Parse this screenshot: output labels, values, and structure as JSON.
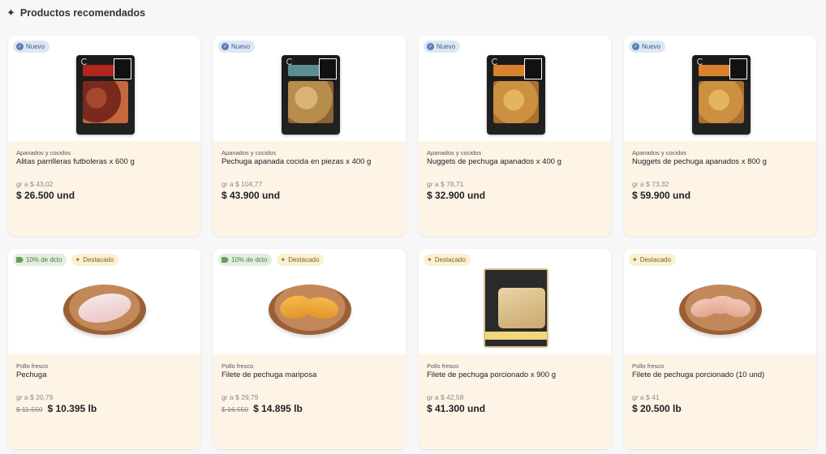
{
  "section": {
    "title": "Productos recomendados",
    "icon": "sparkle-icon"
  },
  "products": [
    {
      "badges": [
        {
          "type": "nuevo",
          "label": "Nuevo",
          "icon": "check-circle-icon"
        }
      ],
      "category": "Apanados y cocidos",
      "name": "Alitas parrilleras futboleras x 600 g",
      "unit_price": "gr a $ 43,02",
      "old_price": "",
      "price": "$ 26.500 und",
      "image": "bag-red"
    },
    {
      "badges": [
        {
          "type": "nuevo",
          "label": "Nuevo",
          "icon": "check-circle-icon"
        }
      ],
      "category": "Apanados y cocidos",
      "name": "Pechuga apanada cocida en piezas x 400 g",
      "unit_price": "gr a $ 104,77",
      "old_price": "",
      "price": "$ 43.900 und",
      "image": "bag-teal"
    },
    {
      "badges": [
        {
          "type": "nuevo",
          "label": "Nuevo",
          "icon": "check-circle-icon"
        }
      ],
      "category": "Apanados y cocidos",
      "name": "Nuggets de pechuga apanados x 400 g",
      "unit_price": "gr a $ 78,71",
      "old_price": "",
      "price": "$ 32.900 und",
      "image": "bag-orange"
    },
    {
      "badges": [
        {
          "type": "nuevo",
          "label": "Nuevo",
          "icon": "check-circle-icon"
        }
      ],
      "category": "Apanados y cocidos",
      "name": "Nuggets de pechuga apanados x 800 g",
      "unit_price": "gr a $ 73,32",
      "old_price": "",
      "price": "$ 59.900 und",
      "image": "bag-orange"
    },
    {
      "badges": [
        {
          "type": "dcto",
          "label": "10% de dcto",
          "icon": "tag-icon"
        },
        {
          "type": "dest",
          "label": "Destacado",
          "icon": "sparkle-icon"
        }
      ],
      "category": "Pollo fresco",
      "name": "Pechuga",
      "unit_price": "gr a $ 20,79",
      "old_price": "$ 11.550",
      "price": "$ 10.395 lb",
      "image": "platter-raw"
    },
    {
      "badges": [
        {
          "type": "dcto",
          "label": "10% de dcto",
          "icon": "tag-icon"
        },
        {
          "type": "dest",
          "label": "Destacado",
          "icon": "sparkle-icon"
        }
      ],
      "category": "Pollo fresco",
      "name": "Filete de pechuga mariposa",
      "unit_price": "gr a $ 29,79",
      "old_price": "$ 16.550",
      "price": "$ 14.895 lb",
      "image": "platter-cooked"
    },
    {
      "badges": [
        {
          "type": "dest",
          "label": "Destacado",
          "icon": "sparkle-icon"
        }
      ],
      "category": "Pollo fresco",
      "name": "Filete de pechuga porcionado x 900 g",
      "unit_price": "gr a $ 42,58",
      "old_price": "",
      "price": "$ 41.300 und",
      "image": "bag-macpollo"
    },
    {
      "badges": [
        {
          "type": "dest",
          "label": "Destacado",
          "icon": "sparkle-icon"
        }
      ],
      "category": "Pollo fresco",
      "name": "Filete de pechuga porcionado (10 und)",
      "unit_price": "gr a $ 41",
      "old_price": "",
      "price": "$ 20.500 lb",
      "image": "platter-pink"
    }
  ]
}
